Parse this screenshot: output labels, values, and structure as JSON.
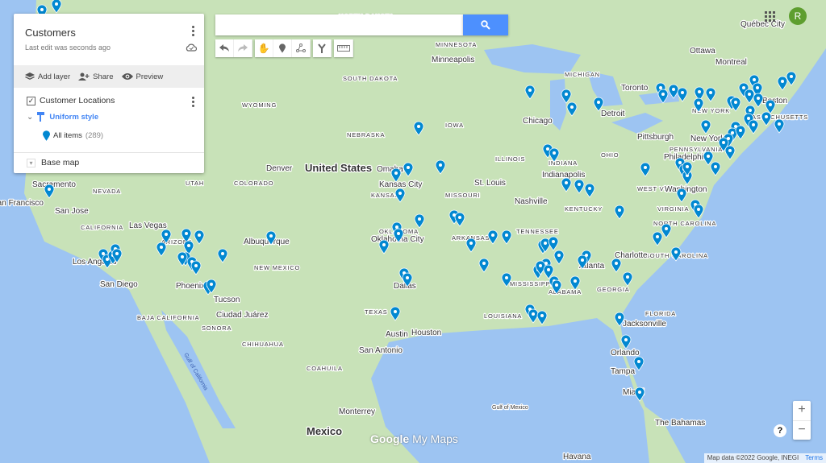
{
  "panel": {
    "title": "Customers",
    "subtitle": "Last edit was seconds ago",
    "actions": {
      "add_layer": "Add layer",
      "share": "Share",
      "preview": "Preview"
    },
    "layer": {
      "name": "Customer Locations",
      "checked": true,
      "style": "Uniform style",
      "items_label": "All items",
      "items_count": "(289)"
    },
    "base_map": "Base map"
  },
  "search": {
    "value": "",
    "placeholder": ""
  },
  "user": {
    "initial": "R",
    "color": "#5e9e2f"
  },
  "colors": {
    "pin": "#0288d1",
    "search_button": "#4d90fe",
    "land": "#c8e2b8",
    "water": "#9dc4f2"
  },
  "toolbar": [
    "undo-icon",
    "redo-icon",
    "hand-icon",
    "add-marker-icon",
    "draw-line-icon",
    "directions-icon",
    "ruler-icon"
  ],
  "zoom": {
    "in": "+",
    "out": "−"
  },
  "help": "?",
  "attribution": {
    "text": "Map data ©2022 Google, INEGI",
    "terms": "Terms"
  },
  "logo": {
    "google": "Google",
    "product": "My Maps"
  },
  "map_labels": {
    "countries": [
      "United States",
      "Mexico"
    ],
    "cities": [
      "Minneapolis",
      "Chicago",
      "Toronto",
      "Ottawa",
      "Montreal",
      "Québec City",
      "Detroit",
      "Boston",
      "New York",
      "Philadelphia",
      "Washington",
      "Pittsburgh",
      "Indianapolis",
      "St. Louis",
      "Kansas City",
      "Omaha",
      "Denver",
      "Sacramento",
      "San Francisco",
      "San Jose",
      "Las Vegas",
      "Los Angeles",
      "San Diego",
      "Phoenix",
      "Tucson",
      "Albuquerque",
      "Ciudad Juárez",
      "Oklahoma City",
      "Dallas",
      "Austin",
      "Houston",
      "San Antonio",
      "Nashville",
      "Atlanta",
      "Charlotte",
      "Jacksonville",
      "Orlando",
      "Tampa",
      "Miami",
      "Monterrey",
      "Mexico",
      "Havana",
      "The Bahamas"
    ],
    "regions": [
      "NORTH DAKOTA",
      "MINNESOTA",
      "SOUTH DAKOTA",
      "WYOMING",
      "NEBRASKA",
      "IOWA",
      "KANSAS",
      "MISSOURI",
      "ILLINOIS",
      "INDIANA",
      "OHIO",
      "MICHIGAN",
      "NEW YORK",
      "PENNSYLVANIA",
      "VIRGINIA",
      "WEST VIRGINIA",
      "KENTUCKY",
      "TENNESSEE",
      "ARKANSAS",
      "OKLAHOMA",
      "TEXAS",
      "NEW MEXICO",
      "ARIZONA",
      "NEVADA",
      "UTAH",
      "COLORADO",
      "CALIFORNIA",
      "NORTH CAROLINA",
      "SOUTH CAROLINA",
      "GEORGIA",
      "ALABAMA",
      "MISSISSIPPI",
      "LOUISIANA",
      "FLORIDA",
      "BAJA CALIFORNIA",
      "SONORA",
      "CHIHUAHUA",
      "COAHUILA",
      "MASSACHUSETTS"
    ],
    "water": [
      "Gulf of Mexico",
      "Gulf of California"
    ]
  }
}
